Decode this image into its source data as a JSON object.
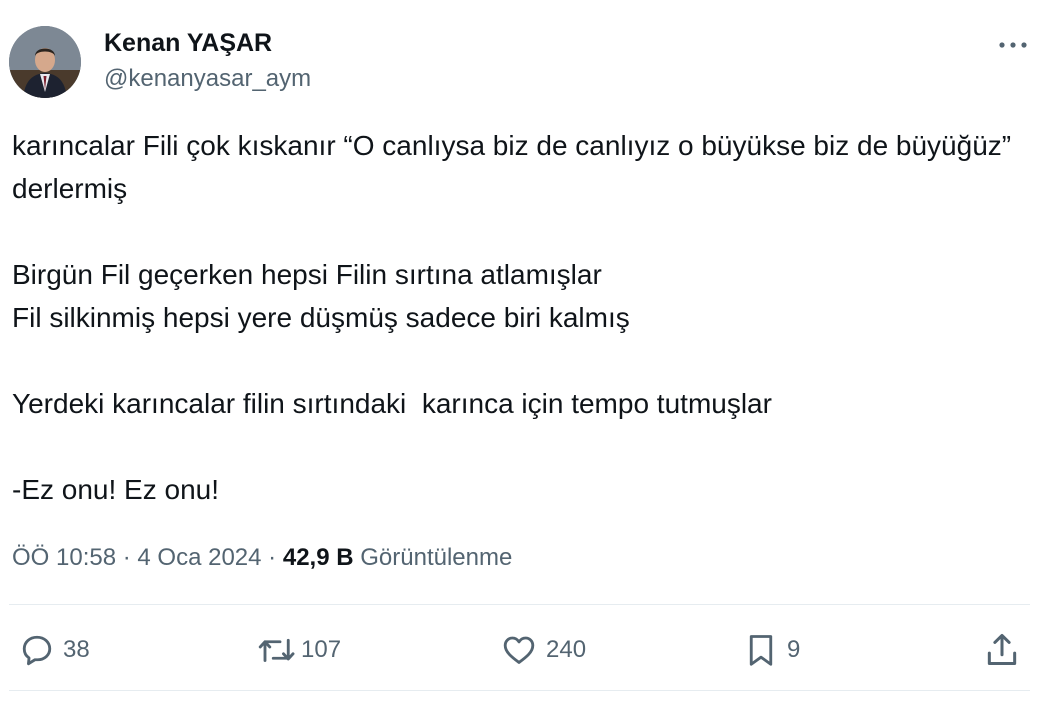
{
  "author": {
    "display_name": "Kenan YAŞAR",
    "handle": "@kenanyasar_aym",
    "avatar_icon": "profile-photo"
  },
  "tweet": {
    "text": "karıncalar Fili çok kıskanır “O canlıysa biz de canlıyız o büyükse biz de büyüğüz” derlermiş\n\nBirgün Fil geçerken hepsi Filin sırtına atlamışlar\nFil silkinmiş hepsi yere düşmüş sadece biri kalmış\n\nYerdeki karıncalar filin sırtındaki  karınca için tempo tutmuşlar\n\n-Ez onu! Ez onu!"
  },
  "meta": {
    "time": "ÖÖ 10:58",
    "separator": "·",
    "date": "4 Oca 2024",
    "views_count": "42,9 B",
    "views_label": "Görüntülenme"
  },
  "actions": {
    "replies": "38",
    "reposts": "107",
    "likes": "240",
    "bookmarks": "9"
  },
  "colors": {
    "text_primary": "#0f1419",
    "text_secondary": "#536471",
    "divider": "#e6ecf0"
  }
}
